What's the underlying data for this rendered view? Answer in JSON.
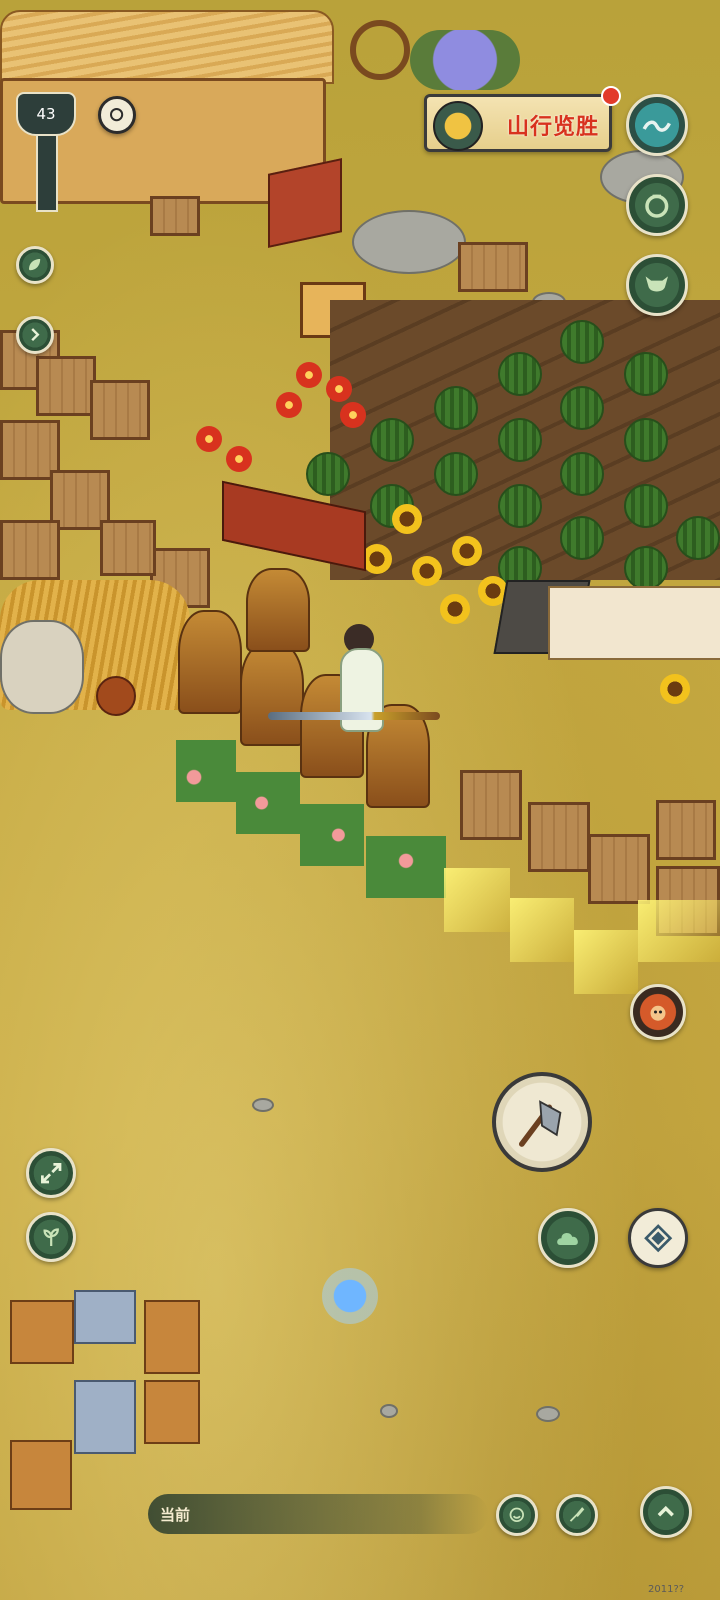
{
  "hud": {
    "player_level": "43",
    "event_banner": "山行览胜",
    "chat_label": "当前",
    "version": "2011??"
  },
  "colors": {
    "grass": "#c7a942",
    "button_green": "#3f6b4a",
    "button_border": "#e8e2c8",
    "banner_text": "#d8321e",
    "notification": "#e23a2a"
  },
  "icons": {
    "top_right": [
      "wave-icon",
      "pot-icon",
      "ox-head-icon"
    ],
    "left": [
      "leaf-icon",
      "chevron-right-icon"
    ],
    "bottom_left": [
      "expand-arrows-icon",
      "planting-icon"
    ],
    "actions": [
      "axe-icon",
      "cloud-skill-icon",
      "diamond-skill-icon",
      "monkey-face-icon"
    ],
    "bottom_bar": [
      "emoji-icon",
      "brush-icon",
      "chevron-up-icon"
    ]
  }
}
